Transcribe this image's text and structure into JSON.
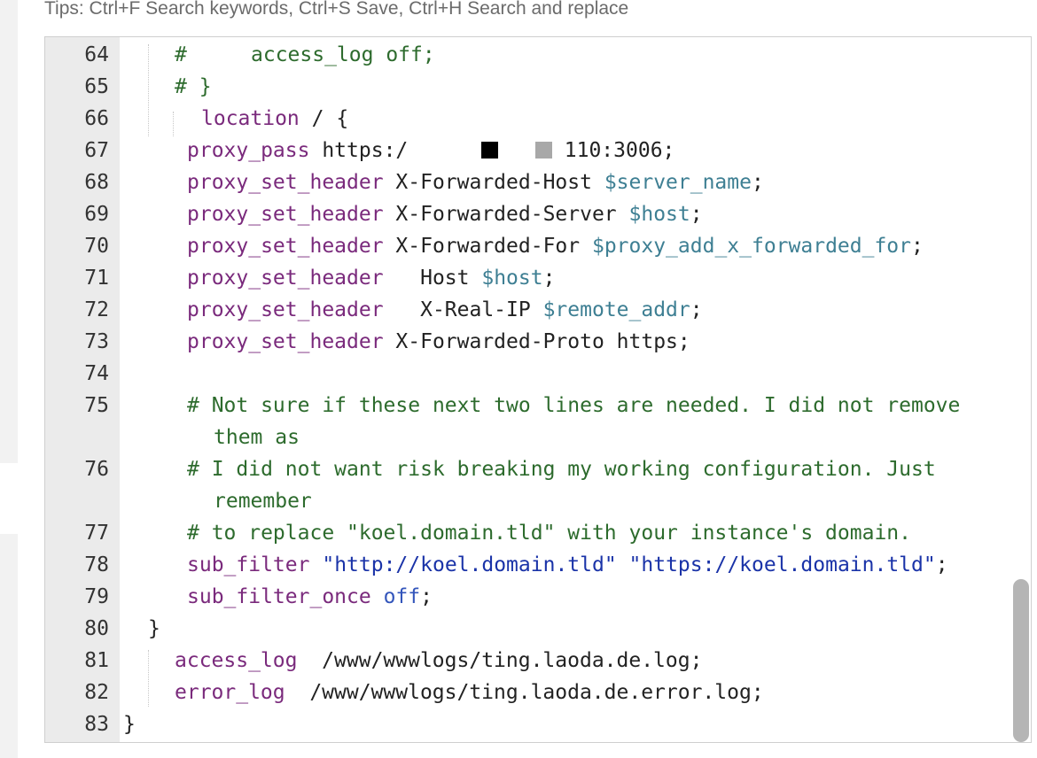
{
  "tips": "Tips:  Ctrl+F Search keywords,  Ctrl+S Save,  Ctrl+H Search and replace",
  "colors": {
    "keyword": "#7a2a7c",
    "variable": "#3e7f93",
    "comment": "#2d6b2d",
    "string": "#1a33a8",
    "gutter": "#ebebeb",
    "scrollbar": "#b5b5b5"
  },
  "lines": {
    "l64": {
      "num": "64",
      "hash": "#",
      "text": "access_log off;"
    },
    "l65": {
      "num": "65",
      "text": "# }"
    },
    "l66": {
      "num": "66",
      "kw": "location",
      "text": " / {"
    },
    "l67": {
      "num": "67",
      "kw": "proxy_pass",
      "text_a": " https:/",
      "text_b": "110:3006;"
    },
    "l68": {
      "num": "68",
      "kw": "proxy_set_header",
      "text": " X-Forwarded-Host ",
      "var": "$server_name",
      "end": ";"
    },
    "l69": {
      "num": "69",
      "kw": "proxy_set_header",
      "text": " X-Forwarded-Server ",
      "var": "$host",
      "end": ";"
    },
    "l70": {
      "num": "70",
      "kw": "proxy_set_header",
      "text": " X-Forwarded-For ",
      "var": "$proxy_add_x_forwarded_for",
      "end": ";"
    },
    "l71": {
      "num": "71",
      "kw": "proxy_set_header",
      "text": "   Host ",
      "var": "$host",
      "end": ";"
    },
    "l72": {
      "num": "72",
      "kw": "proxy_set_header",
      "text": "   X-Real-IP ",
      "var": "$remote_addr",
      "end": ";"
    },
    "l73": {
      "num": "73",
      "kw": "proxy_set_header",
      "text": " X-Forwarded-Proto https;"
    },
    "l74": {
      "num": "74"
    },
    "l75": {
      "num": "75",
      "cmt": "# Not sure if these next two lines are needed. I did not remove",
      "cont": "them as"
    },
    "l76": {
      "num": "76",
      "cmt": "# I did not want risk breaking my working configuration. Just",
      "cont": "remember"
    },
    "l77": {
      "num": "77",
      "cmt": "# to replace \"koel.domain.tld\" with your instance's domain."
    },
    "l78": {
      "num": "78",
      "kw": "sub_filter",
      "str1": "\"http://koel.domain.tld\"",
      "str2": "\"https://koel.domain.tld\"",
      "end": ";"
    },
    "l79": {
      "num": "79",
      "kw": "sub_filter_once",
      "val": "off",
      "end": ";"
    },
    "l80": {
      "num": "80",
      "text": "}"
    },
    "l81": {
      "num": "81",
      "kw": "access_log",
      "text": "  /www/wwwlogs/ting.laoda.de.log;"
    },
    "l82": {
      "num": "82",
      "kw": "error_log",
      "text": "  /www/wwwlogs/ting.laoda.de.error.log;"
    },
    "l83": {
      "num": "83",
      "text": "}"
    }
  }
}
